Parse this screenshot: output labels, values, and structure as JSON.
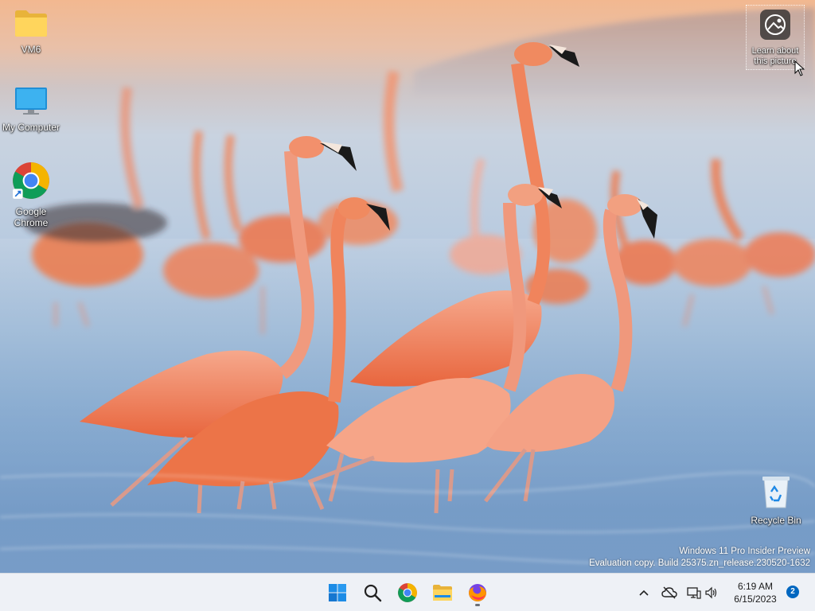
{
  "desktop": {
    "icons": [
      {
        "label": "VM6",
        "icon": "folder-icon"
      },
      {
        "label": "My Computer",
        "icon": "monitor-icon"
      },
      {
        "label": "Google Chrome",
        "icon": "chrome-icon"
      },
      {
        "label": "Recycle Bin",
        "icon": "recycle-bin-icon"
      }
    ],
    "learn_about_picture": {
      "label": "Learn about this picture",
      "icon": "camera-icon"
    },
    "watermark": {
      "line1": "Windows 11 Pro Insider Preview",
      "line2": "Evaluation copy. Build 25375.zn_release.230520-1632"
    }
  },
  "taskbar": {
    "apps": [
      {
        "name": "Start",
        "icon": "windows-start-icon"
      },
      {
        "name": "Search",
        "icon": "search-icon"
      },
      {
        "name": "Google Chrome",
        "icon": "chrome-icon"
      },
      {
        "name": "File Explorer",
        "icon": "folder-icon"
      },
      {
        "name": "Firefox",
        "icon": "firefox-icon",
        "running": true
      }
    ],
    "tray": {
      "icons": [
        "chevron-up-icon",
        "cloud-offline-icon",
        "network-icon",
        "volume-icon"
      ],
      "time": "6:19 AM",
      "date": "6/15/2023",
      "notification_count": "2"
    }
  },
  "colors": {
    "taskbar_bg": "#eef1f6",
    "accent": "#0067c0",
    "flamingo": "#f0805a"
  }
}
